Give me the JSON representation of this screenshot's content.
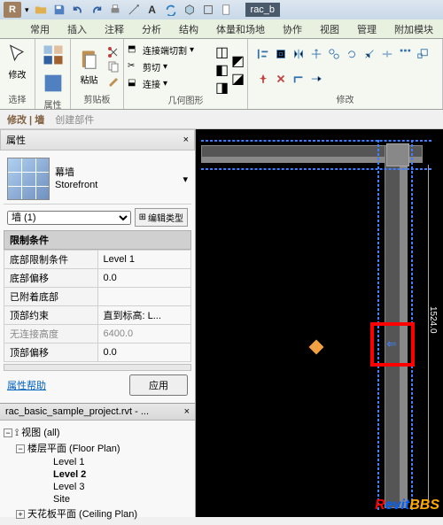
{
  "app": {
    "logo_letter": "R",
    "doc_name_short": "rac_b"
  },
  "ribbon": {
    "tabs": [
      "常用",
      "插入",
      "注释",
      "分析",
      "结构",
      "体量和场地",
      "协作",
      "视图",
      "管理",
      "附加模块"
    ],
    "labels": {
      "select": "选择",
      "properties": "属性",
      "clipboard": "剪贴板",
      "geometry": "几何图形",
      "modify": "修改"
    },
    "modify_btn": "修改",
    "paste": {
      "label": "粘贴"
    },
    "geom": {
      "join_cut": "连接端切割",
      "cut": "剪切",
      "join": "连接"
    }
  },
  "context": {
    "modify_wall": "修改 | 墙",
    "create_parts": "创建部件"
  },
  "panels": {
    "properties_title": "属性"
  },
  "type": {
    "family": "幕墙",
    "name": "Storefront"
  },
  "instance": {
    "selector": "墙 (1)",
    "edit_type": "编辑类型"
  },
  "constraints": {
    "header": "限制条件",
    "rows": [
      {
        "label": "底部限制条件",
        "value": "Level 1",
        "readonly": false
      },
      {
        "label": "底部偏移",
        "value": "0.0",
        "readonly": false
      },
      {
        "label": "已附着底部",
        "value": "",
        "readonly": true
      },
      {
        "label": "顶部约束",
        "value": "直到标高: L...",
        "readonly": false
      },
      {
        "label": "无连接高度",
        "value": "6400.0",
        "readonly": true
      },
      {
        "label": "顶部偏移",
        "value": "0.0",
        "readonly": false
      }
    ]
  },
  "props_footer": {
    "help": "属性帮助",
    "apply": "应用"
  },
  "browser": {
    "title": "rac_basic_sample_project.rvt - ...",
    "views_all": "视图 (all)",
    "floor_plans": "楼层平面 (Floor Plan)",
    "levels": [
      "Level 1",
      "Level 2",
      "Level 3",
      "Site"
    ],
    "ceiling_plans": "天花板平面 (Ceiling Plan)"
  },
  "canvas": {
    "dimension": "1524.0"
  },
  "watermark": {
    "text_revit": "Revit",
    "text_bbs": "BBS"
  }
}
